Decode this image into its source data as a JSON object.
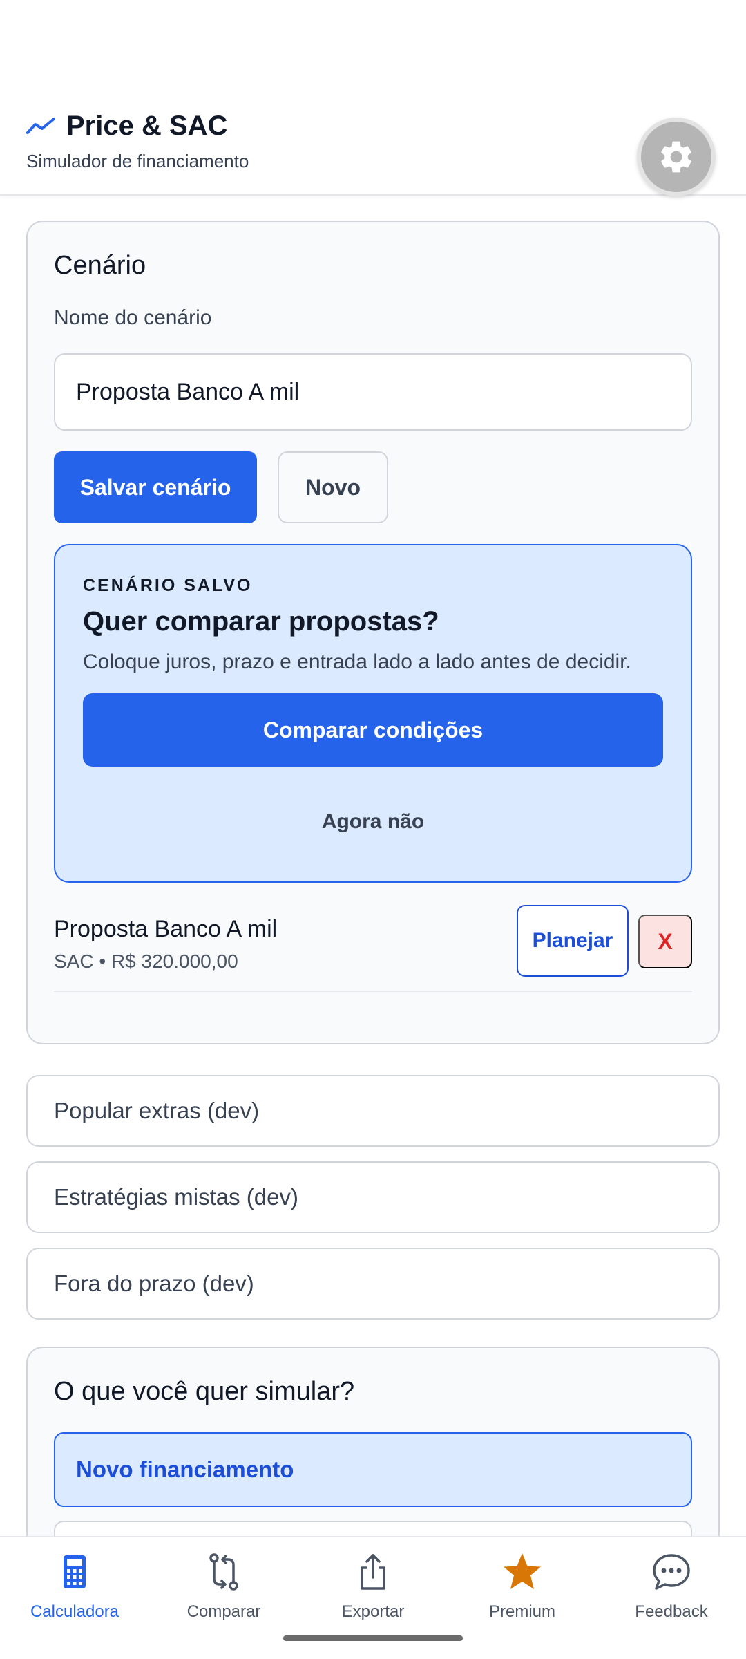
{
  "header": {
    "title": "Price & SAC",
    "subtitle": "Simulador de financiamento",
    "accent_color": "#2563eb",
    "brand_icon": "trend-line-icon",
    "settings_icon": "gear-icon"
  },
  "scenario": {
    "title": "Cenário",
    "name_label": "Nome do cenário",
    "name_value": "Proposta Banco A mil",
    "save_label": "Salvar cenário",
    "new_label": "Novo",
    "promo": {
      "eyebrow": "CENÁRIO SALVO",
      "title": "Quer comparar propostas?",
      "description": "Coloque juros, prazo e entrada lado a lado antes de decidir.",
      "cta_label": "Comparar condições",
      "dismiss_label": "Agora não"
    },
    "saved": [
      {
        "name": "Proposta Banco A mil",
        "meta": "SAC • R$ 320.000,00",
        "plan_label": "Planejar",
        "delete_label": "X"
      }
    ]
  },
  "dev_items": [
    "Popular extras (dev)",
    "Estratégias mistas (dev)",
    "Fora do prazo (dev)"
  ],
  "simulate": {
    "title": "O que você quer simular?",
    "selected_option": "Novo financiamento"
  },
  "bottom_nav": [
    {
      "label": "Calculadora",
      "icon": "calculator-icon",
      "active": true
    },
    {
      "label": "Comparar",
      "icon": "compare-arrows-icon",
      "active": false
    },
    {
      "label": "Exportar",
      "icon": "share-upload-icon",
      "active": false
    },
    {
      "label": "Premium",
      "icon": "star-icon",
      "active": false
    },
    {
      "label": "Feedback",
      "icon": "chat-bubble-icon",
      "active": false
    }
  ],
  "colors": {
    "primary": "#2563eb",
    "promo_bg": "#dbeafe",
    "premium": "#d97706",
    "danger": "#dc2626"
  }
}
